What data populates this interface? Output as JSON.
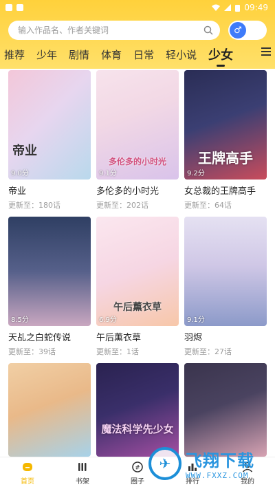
{
  "status_bar": {
    "time": "09:49"
  },
  "search": {
    "placeholder": "输入作品名、作者关键词"
  },
  "gender_toggle": {
    "symbol": "♂"
  },
  "tabs": [
    {
      "label": "推荐",
      "active": false
    },
    {
      "label": "少年",
      "active": false
    },
    {
      "label": "剧情",
      "active": false
    },
    {
      "label": "体育",
      "active": false
    },
    {
      "label": "日常",
      "active": false
    },
    {
      "label": "轻小说",
      "active": false
    },
    {
      "label": "少女",
      "active": true
    }
  ],
  "comics": [
    {
      "title": "帝业",
      "update": "更新至：180话",
      "rating": "9.0分",
      "cover_text": "帝业",
      "colors": [
        "#f3c7d9",
        "#b9d8ec"
      ]
    },
    {
      "title": "多伦多的小时光",
      "update": "更新至：202话",
      "rating": "9.1分",
      "cover_text": "多伦多的小时光",
      "colors": [
        "#f2d8e5",
        "#d9c3ea"
      ]
    },
    {
      "title": "女总裁的王牌高手",
      "update": "更新至：64话",
      "rating": "9.2分",
      "cover_text": "王牌高手",
      "colors": [
        "#3b3f73",
        "#c94c5c"
      ]
    },
    {
      "title": "天乩之白蛇传说",
      "update": "更新至：39话",
      "rating": "8.5分",
      "cover_text": "",
      "colors": [
        "#2f3f63",
        "#c9a7c0"
      ]
    },
    {
      "title": "午后薰衣草",
      "update": "更新至：1话",
      "rating": "6.9分",
      "cover_text": "午后薰衣草",
      "colors": [
        "#f6d6e3",
        "#f7c7a9"
      ]
    },
    {
      "title": "羽烬",
      "update": "更新至：27话",
      "rating": "9.1分",
      "cover_text": "",
      "colors": [
        "#cfc7e6",
        "#8c9ac9"
      ]
    },
    {
      "title": "",
      "update": "",
      "rating": "",
      "cover_text": "",
      "colors": [
        "#e9b989",
        "#a7d2e9"
      ]
    },
    {
      "title": "",
      "update": "",
      "rating": "",
      "cover_text": "魔法科学先少女",
      "colors": [
        "#3a2f6a",
        "#a44fa2"
      ]
    },
    {
      "title": "",
      "update": "",
      "rating": "",
      "cover_text": "",
      "colors": [
        "#4a4360",
        "#d7a3b3"
      ]
    }
  ],
  "bottom_nav": [
    {
      "label": "首页",
      "active": true
    },
    {
      "label": "书架",
      "active": false
    },
    {
      "label": "圈子",
      "active": false
    },
    {
      "label": "排行",
      "active": false
    },
    {
      "label": "我的",
      "active": false
    }
  ],
  "watermark": {
    "big": "飞翔下载",
    "small": "WWW.FXXZ.COM"
  },
  "colors": {
    "accent": "#FFD13B",
    "nav_active": "#F5B800",
    "toggle": "#3E7BFA"
  }
}
